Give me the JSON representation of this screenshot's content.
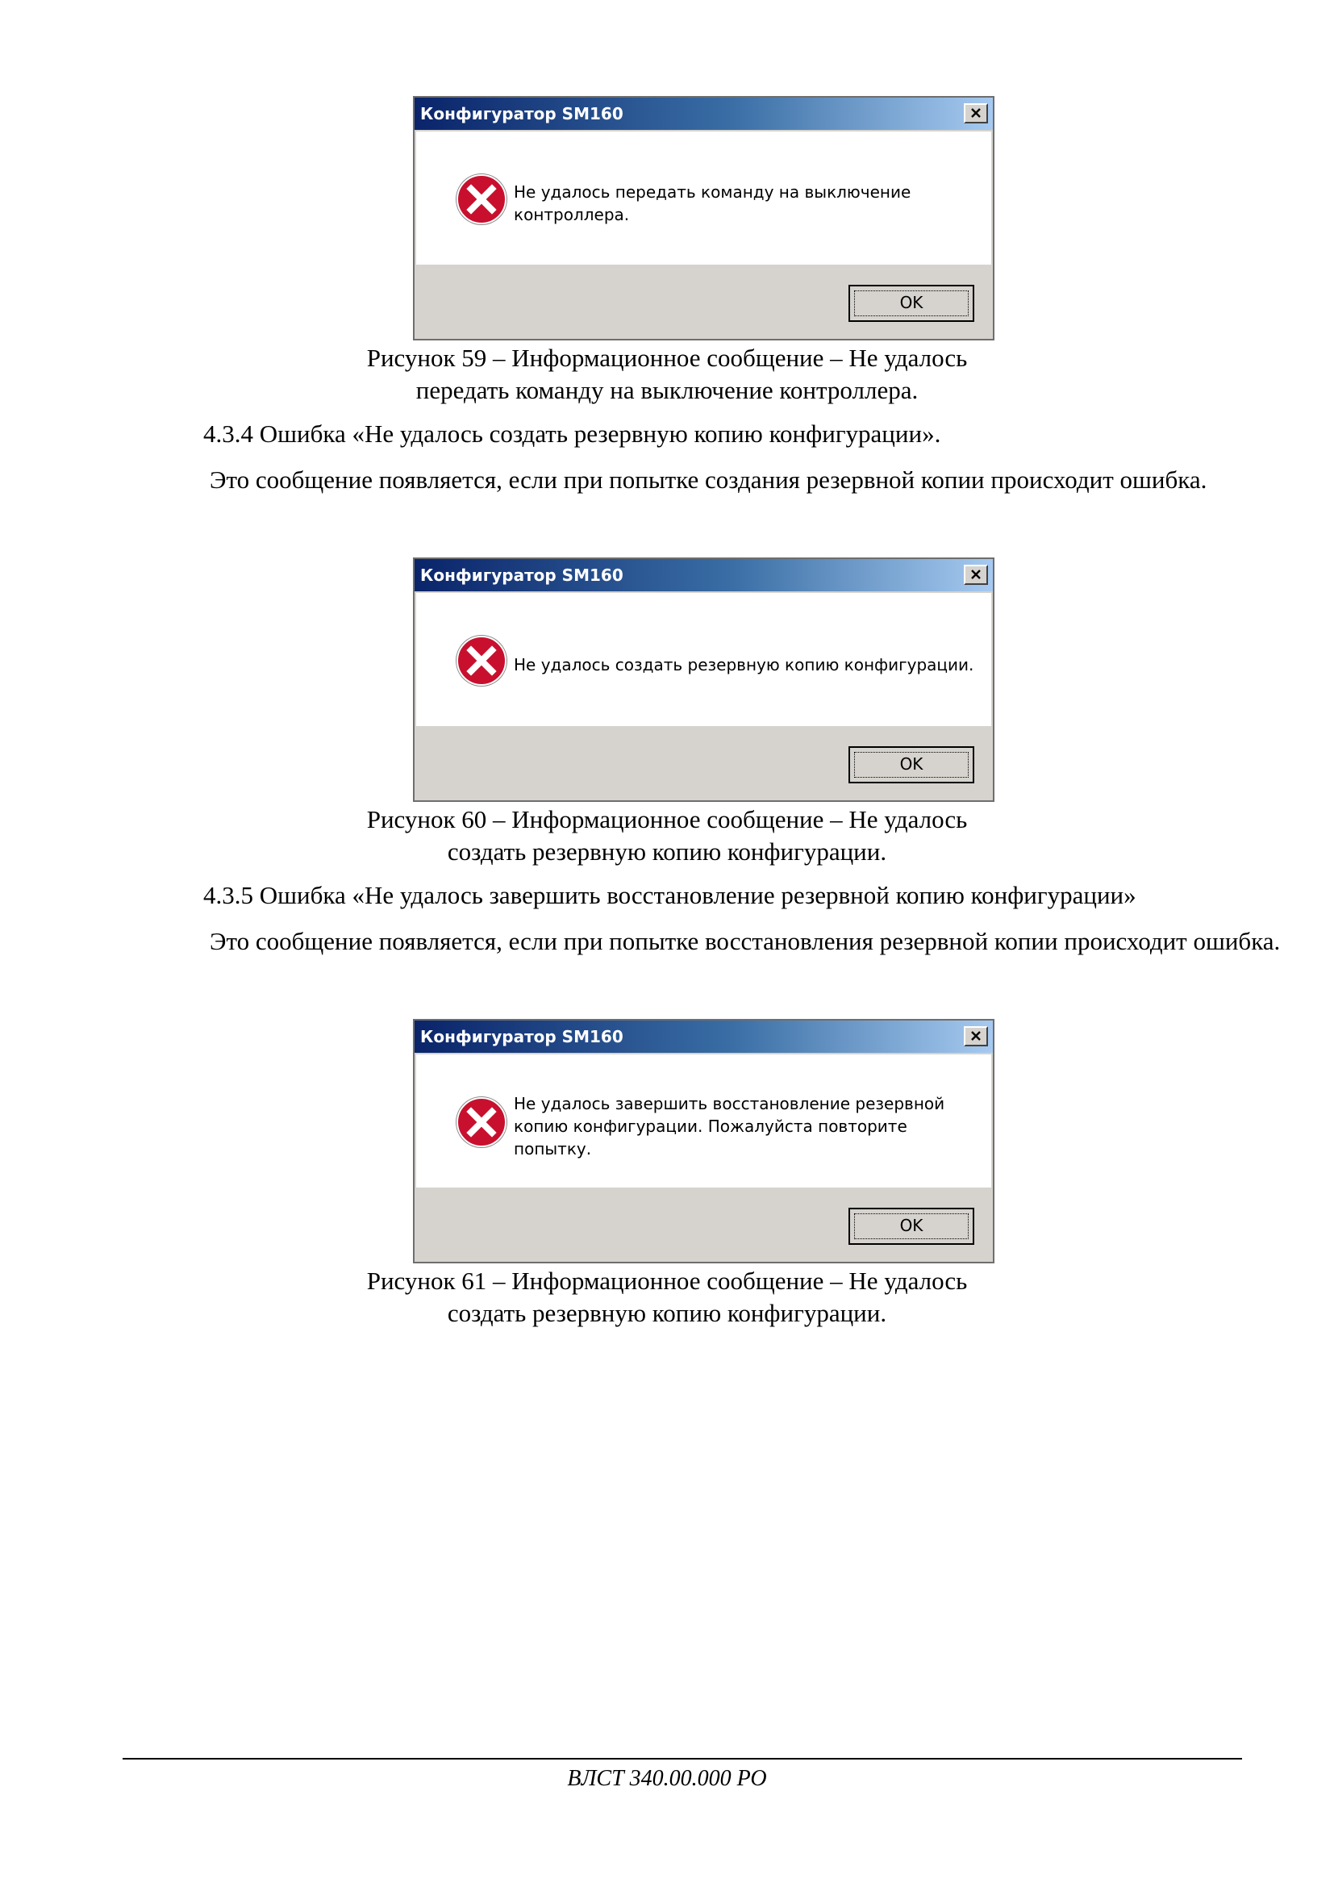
{
  "figures": [
    {
      "dialog": {
        "title": "Конфигуратор SM160",
        "message_lines": [
          "Не удалось передать команду на выключение",
          "контроллера."
        ],
        "ok_label": "OK"
      },
      "caption_lines": [
        "Рисунок 59 – Информационное сообщение – Не удалось",
        "передать команду на выключение контроллера."
      ]
    },
    {
      "dialog": {
        "title": "Конфигуратор SM160",
        "message_lines": [
          "Не удалось создать резервную копию конфигурации."
        ],
        "ok_label": "OK"
      },
      "caption_lines": [
        "Рисунок 60 – Информационное сообщение – Не удалось",
        "создать резервную копию конфигурации."
      ]
    },
    {
      "dialog": {
        "title": "Конфигуратор SM160",
        "message_lines": [
          "Не удалось завершить восстановление резервной",
          "копию конфигурации. Пожалуйста повторите",
          "попытку."
        ],
        "ok_label": "OK"
      },
      "caption_lines": [
        "Рисунок 61 – Информационное сообщение – Не удалось",
        "создать резервную копию конфигурации."
      ]
    }
  ],
  "sections": [
    {
      "heading": "4.3.4 Ошибка «Не удалось создать резервную копию конфигурации».",
      "paragraph": "Это сообщение появляется, если при попытке создания резервной копии происходит ошибка."
    },
    {
      "heading": "4.3.5 Ошибка «Не удалось завершить восстановление резервной копию конфигурации»",
      "paragraph": "Это сообщение появляется, если при попытке восстановления резервной копии происходит ошибка."
    }
  ],
  "footer": "ВЛСТ 340.00.000 РО",
  "icons": {
    "error": "error-x-icon",
    "close": "close-icon"
  },
  "colors": {
    "titlebar_start": "#0a246a",
    "titlebar_end": "#a6caf0",
    "error_red": "#c8102e",
    "dialog_face": "#d6d3ce"
  }
}
